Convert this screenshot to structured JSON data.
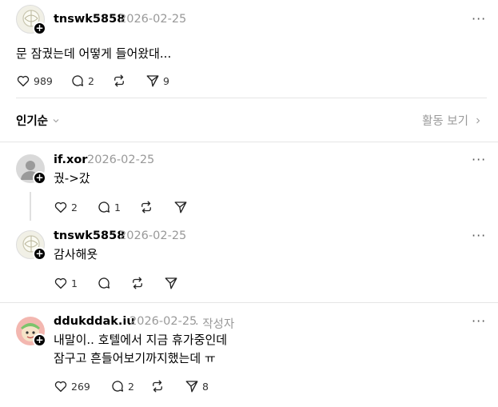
{
  "post": {
    "username": "tnswk5858",
    "date": "2026-02-25",
    "text": "문 잠궜는데 어떻게 들어왔대...",
    "likes": "989",
    "comments": "2",
    "shares": "9"
  },
  "sort": {
    "label": "인기순",
    "activity_label": "활동 보기"
  },
  "replies": [
    {
      "username": "if.xor",
      "date": "2026-02-25",
      "text": "궜->갔",
      "likes": "2",
      "comments": "1"
    },
    {
      "username": "tnswk5858",
      "date": "2026-02-25",
      "text": "감사해욧",
      "likes": "1"
    },
    {
      "username": "ddukddak.iu",
      "date": "2026-02-25",
      "author_tag": "· 작성자",
      "text_line1": "내말이.. 호텔에서 지금 휴가중인데",
      "text_line2": "잠구고 흔들어보기까지했는데 ㅠ",
      "likes": "269",
      "comments": "2",
      "shares": "8"
    }
  ],
  "icons": {
    "more": "more-horizontal-icon",
    "like": "heart-icon",
    "comment": "comment-icon",
    "repost": "repost-icon",
    "share": "send-icon"
  }
}
